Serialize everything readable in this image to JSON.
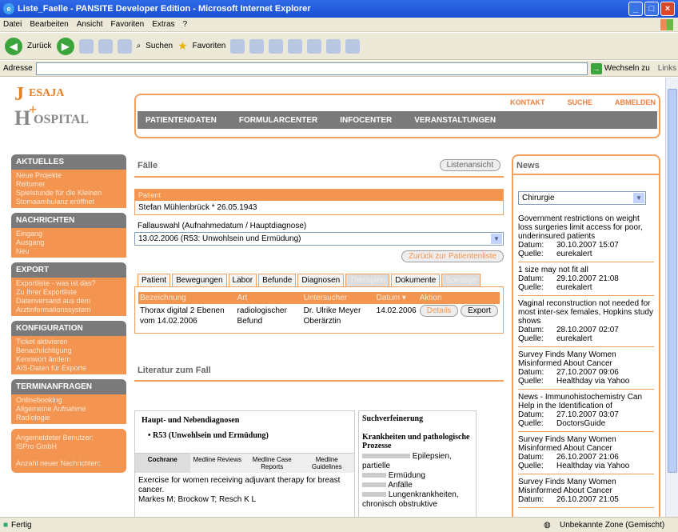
{
  "window": {
    "title": "Liste_Faelle - PANSITE Developer Edition - Microsoft Internet Explorer"
  },
  "menu": [
    "Datei",
    "Bearbeiten",
    "Ansicht",
    "Favoriten",
    "Extras",
    "?"
  ],
  "toolbar": {
    "back": "Zurück",
    "search": "Suchen",
    "favorites": "Favoriten"
  },
  "address": {
    "label": "Adresse",
    "value": "",
    "go": "Wechseln zu",
    "links": "Links"
  },
  "logo": {
    "line1": "J",
    "line2": "ESAJA",
    "line3": "H",
    "line4": "OSPITAL"
  },
  "toplinks": [
    "KONTAKT",
    "SUCHE",
    "ABMELDEN"
  ],
  "mainnav": [
    "PATIENTENDATEN",
    "FORMULARCENTER",
    "INFOCENTER",
    "VERANSTALTUNGEN"
  ],
  "sidebar": [
    {
      "title": "AKTUELLES",
      "items": [
        "Neue Projekte",
        "Reitumer",
        "Spielstunde für die Kleinen",
        "Stomaambulanz eröffnet"
      ]
    },
    {
      "title": "NACHRICHTEN",
      "items": [
        "Eingang",
        "Ausgang",
        "Neu"
      ]
    },
    {
      "title": "EXPORT",
      "items": [
        "Exportliste - was ist das?",
        "Zu Ihrer Exportliste",
        "Datenversand aus dem",
        "Arztinformationssystem"
      ]
    },
    {
      "title": "KONFIGURATION",
      "items": [
        "Ticket aktivieren",
        "Benachrichtigung",
        "Kennwort ändern",
        "AIS-Daten für Exporte"
      ]
    },
    {
      "title": "TERMINANFRAGEN",
      "items": [
        "Onlinebooking",
        "Allgemeine Aufnahme",
        "Radiologie"
      ]
    },
    {
      "title": "",
      "items": [
        "Angemeldeter Benutzer:",
        "ISPro GmbH",
        "",
        "Anzahl neuer Nachrichten:"
      ]
    }
  ],
  "faelle": {
    "title": "Fälle",
    "listenansicht": "Listenansicht",
    "patient_label": "Patient",
    "patient_value": "Stefan Mühlenbrück * 26.05.1943",
    "fallauswahl_label": "Fallauswahl (Aufnahmedatum / Hauptdiagnose)",
    "fallauswahl_value": "13.02.2006 (R53: Unwohlsein und Ermüdung)",
    "zurueck": "Zurück zur Patientenliste"
  },
  "tabs": [
    {
      "label": "Patient",
      "disabled": false
    },
    {
      "label": "Bewegungen",
      "disabled": false
    },
    {
      "label": "Labor",
      "disabled": false
    },
    {
      "label": "Befunde",
      "disabled": false
    },
    {
      "label": "Diagnosen",
      "disabled": false
    },
    {
      "label": "Therapien",
      "disabled": true
    },
    {
      "label": "Dokumente",
      "disabled": false
    },
    {
      "label": "Sonstige",
      "disabled": true
    }
  ],
  "table": {
    "headers": [
      "Bezeichnung",
      "Art",
      "Untersucher",
      "Datum",
      "Aktion"
    ],
    "rows": [
      {
        "bez": "Thorax digital 2 Ebenen vom 14.02.2006",
        "art": "radiologischer Befund",
        "unt": "Dr. Ulrike Meyer Oberärztin",
        "datum": "14.02.2006",
        "details": "Details",
        "export": "Export"
      }
    ]
  },
  "literatur": {
    "title": "Literatur zum Fall",
    "diag_title": "Haupt- und Nebendiagnosen",
    "diag_item": "R53 (Unwohlsein und Ermüdung)",
    "tabs": [
      "Cochrane",
      "Medline Reviews",
      "Medline Case Reports",
      "Medline Guidelines"
    ],
    "text": "Exercise for women receiving adjuvant therapy for breast cancer.",
    "authors": "Markes M; Brockow T; Resch K L"
  },
  "suche": {
    "title": "Suchverfeinerung",
    "subtitle": "Krankheiten und pathologische Prozesse",
    "items": [
      "Epilepsien, partielle",
      "Ermüdung",
      "Anfälle",
      "Lungenkrankheiten, chronisch obstruktive"
    ]
  },
  "news": {
    "title": "News",
    "select": "Chirurgie",
    "items": [
      {
        "headline": "Government restrictions on weight loss surgeries limit access for poor, underinsured patients",
        "datum": "30.10.2007 15:07",
        "quelle": "eurekalert"
      },
      {
        "headline": "1 size may not fit all",
        "datum": "29.10.2007 21:08",
        "quelle": "eurekalert"
      },
      {
        "headline": "Vaginal reconstruction not needed for most inter-sex females, Hopkins study shows",
        "datum": "28.10.2007 02:07",
        "quelle": "eurekalert"
      },
      {
        "headline": "Survey Finds Many Women Misinformed About Cancer",
        "datum": "27.10.2007 09:06",
        "quelle": "Healthday via Yahoo"
      },
      {
        "headline": "News - Immunohistochemistry Can Help in the Identification of",
        "datum": "27.10.2007 03:07",
        "quelle": "DoctorsGuide"
      },
      {
        "headline": "Survey Finds Many Women Misinformed About Cancer",
        "datum": "26.10.2007 21:06",
        "quelle": "Healthday via Yahoo"
      },
      {
        "headline": "Survey Finds Many Women Misinformed About Cancer",
        "datum": "26.10.2007 21:05",
        "quelle": ""
      }
    ]
  },
  "status": {
    "left": "Fertig",
    "zone": "Unbekannte Zone (Gemischt)"
  }
}
